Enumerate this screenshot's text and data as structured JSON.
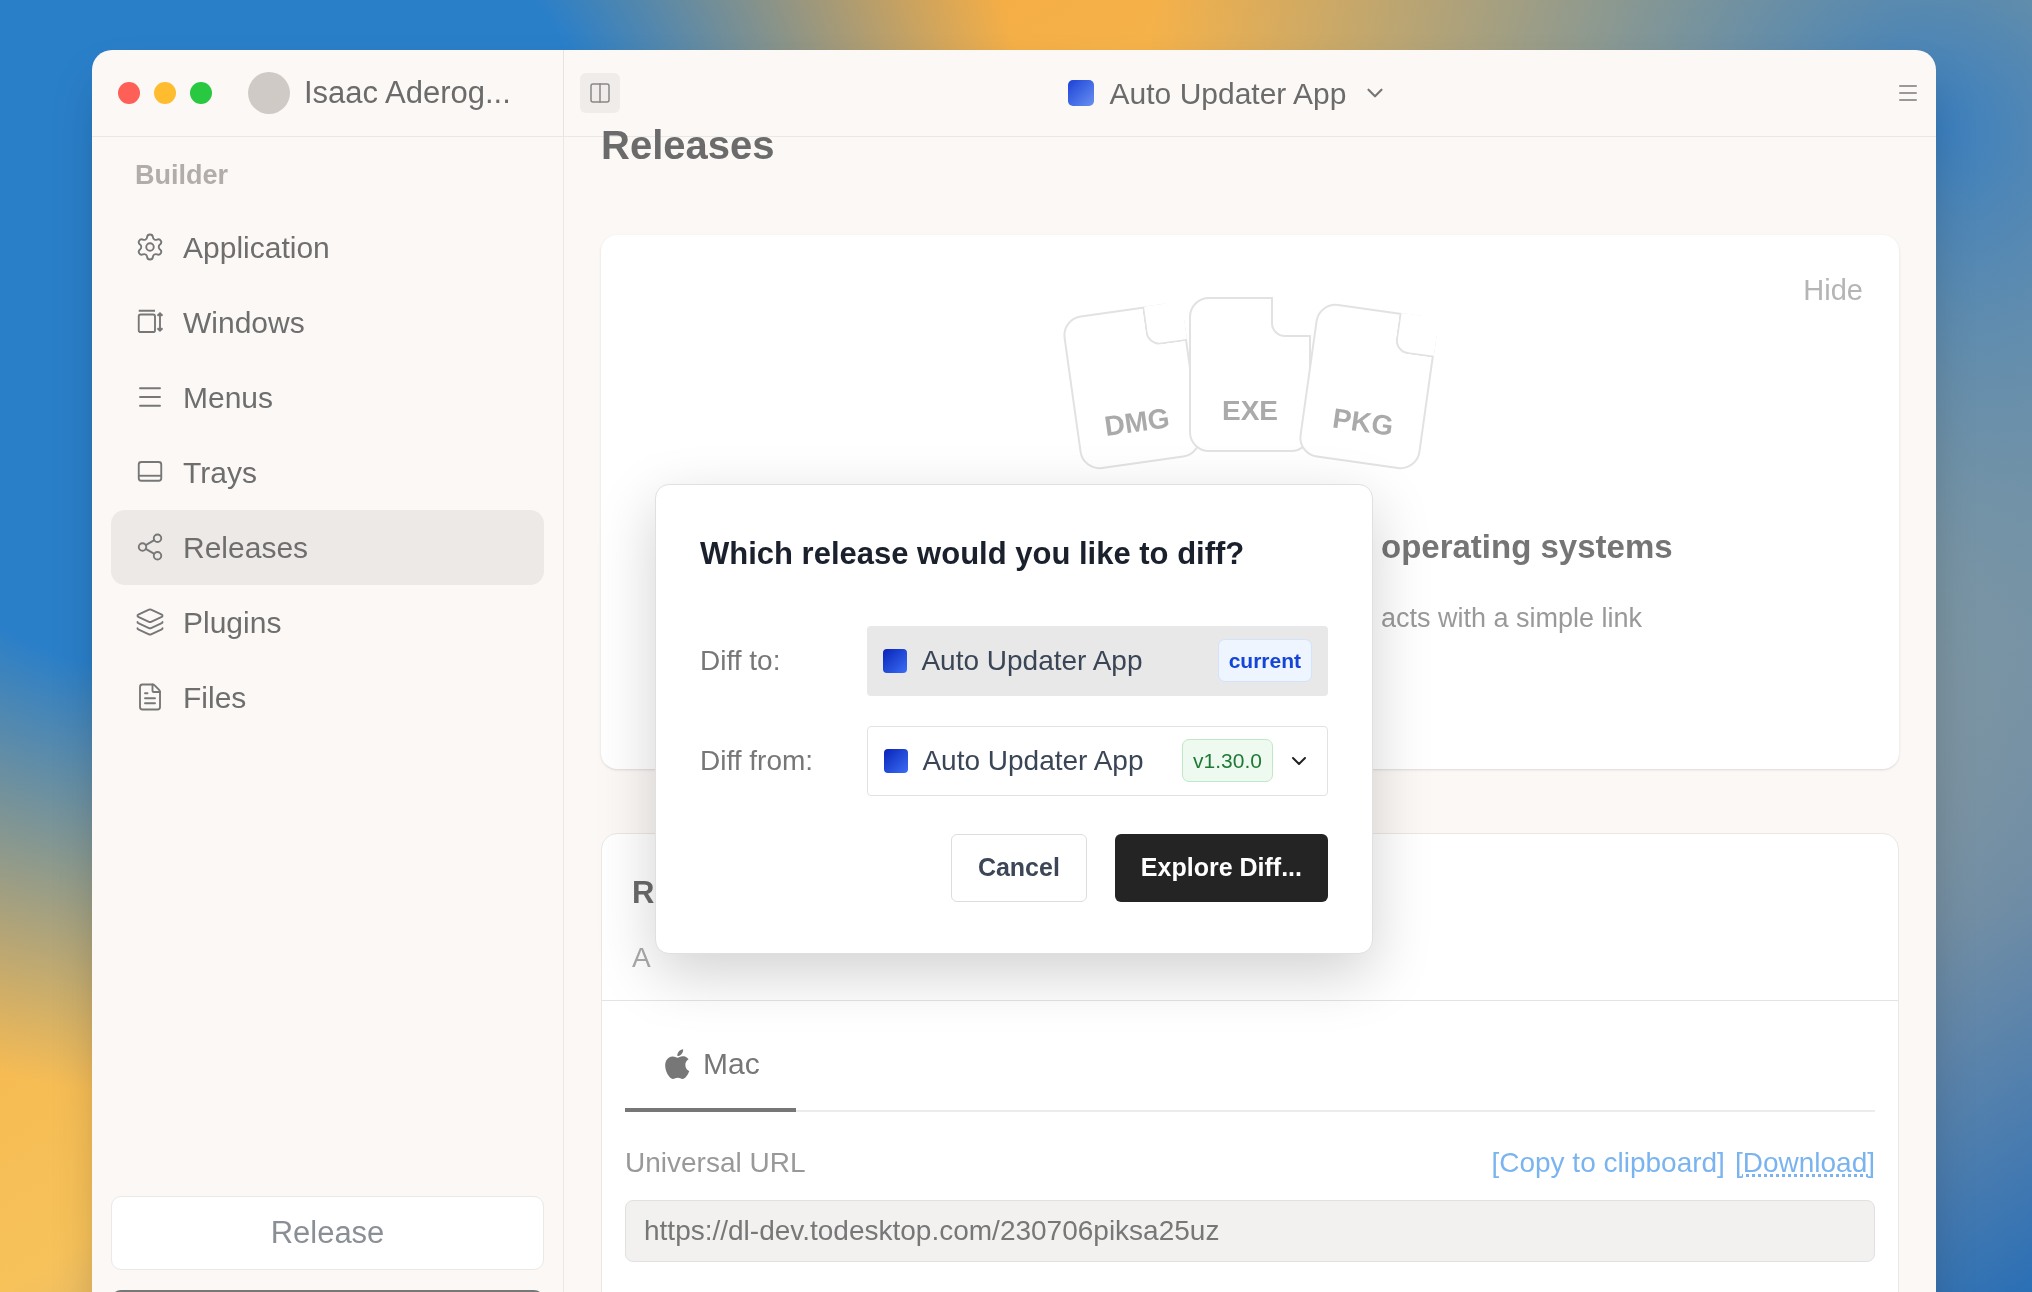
{
  "window": {
    "user": "Isaac Aderog...",
    "app_title": "Auto Updater App"
  },
  "sidebar": {
    "section": "Builder",
    "items": [
      {
        "label": "Application",
        "selected": false
      },
      {
        "label": "Windows",
        "selected": false
      },
      {
        "label": "Menus",
        "selected": false
      },
      {
        "label": "Trays",
        "selected": false
      },
      {
        "label": "Releases",
        "selected": true
      },
      {
        "label": "Plugins",
        "selected": false
      },
      {
        "label": "Files",
        "selected": false
      }
    ],
    "release_button": "Release"
  },
  "page": {
    "title": "Releases",
    "intro_card": {
      "hide": "Hide",
      "files": [
        "DMG",
        "EXE",
        "PKG"
      ],
      "title": "operating systems",
      "subtitle": "acts with a simple link"
    },
    "release_card": {
      "title": "R",
      "subtitle": "A",
      "tabs": [
        {
          "label": "Mac",
          "selected": true
        }
      ],
      "url_label": "Universal URL",
      "links": [
        {
          "label": "[Copy to clipboard]",
          "underlined": false
        },
        {
          "label": "[Download]",
          "underlined": true
        }
      ],
      "url": "https://dl-dev.todesktop.com/230706piksa25uz"
    }
  },
  "dialog": {
    "title": "Which release would you like to diff?",
    "rows": [
      {
        "label": "Diff to:",
        "value": "Auto Updater App",
        "badge": "current",
        "kind": "readonly"
      },
      {
        "label": "Diff from:",
        "value": "Auto Updater App",
        "badge": "v1.30.0",
        "kind": "select"
      }
    ],
    "buttons": [
      {
        "label": "Cancel",
        "kind": "secondary"
      },
      {
        "label": "Explore Diff...",
        "kind": "primary"
      }
    ]
  }
}
